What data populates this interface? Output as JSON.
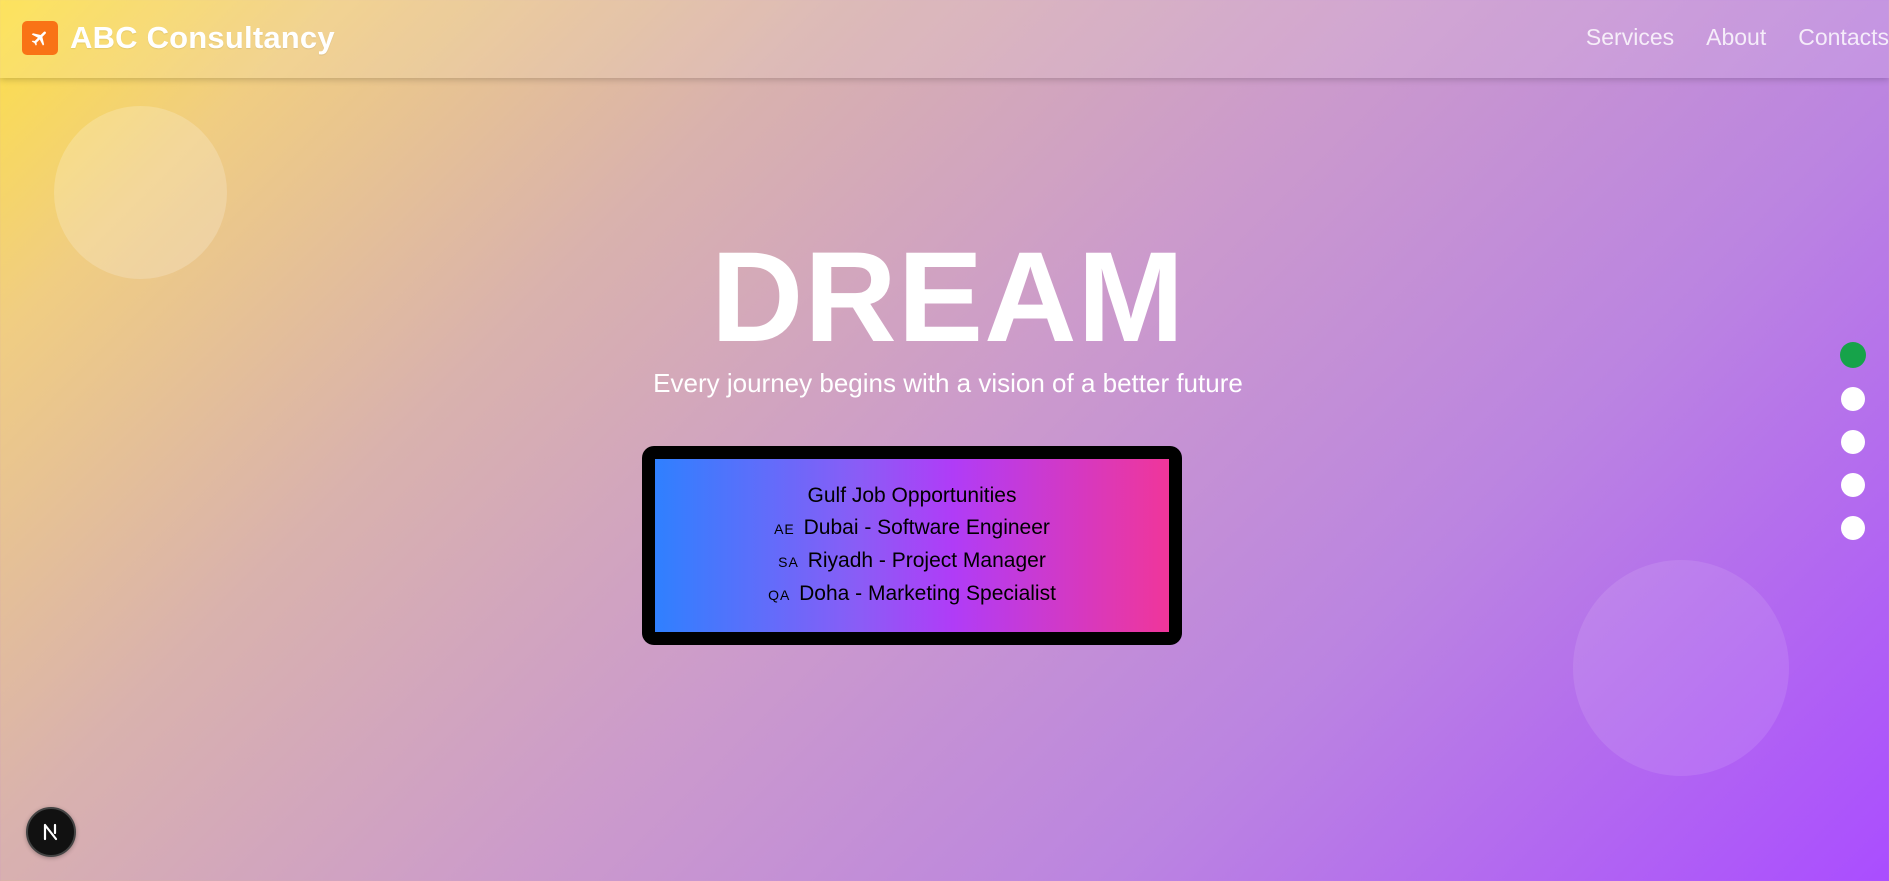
{
  "header": {
    "brand_name": "ABC Consultancy",
    "logo_icon": "plane-icon",
    "nav": [
      "Services",
      "About",
      "Contacts"
    ]
  },
  "hero": {
    "title": "DREAM",
    "subtitle": "Every journey begins with a vision of a better future"
  },
  "jobs_card": {
    "heading": "Gulf Job Opportunities",
    "jobs": [
      {
        "flag": "AE",
        "text": "Dubai - Software Engineer"
      },
      {
        "flag": "SA",
        "text": "Riyadh - Project Manager"
      },
      {
        "flag": "QA",
        "text": "Doha - Marketing Specialist"
      }
    ]
  },
  "slider": {
    "dot_count": 5,
    "active_index": 0,
    "active_color": "#16a34a"
  },
  "dev_badge": {
    "letter": "N",
    "icon": "nextjs-icon"
  },
  "colors": {
    "logo_bg": "#f97316",
    "gradient_start": "#fde047",
    "gradient_end": "#aa4dff"
  }
}
